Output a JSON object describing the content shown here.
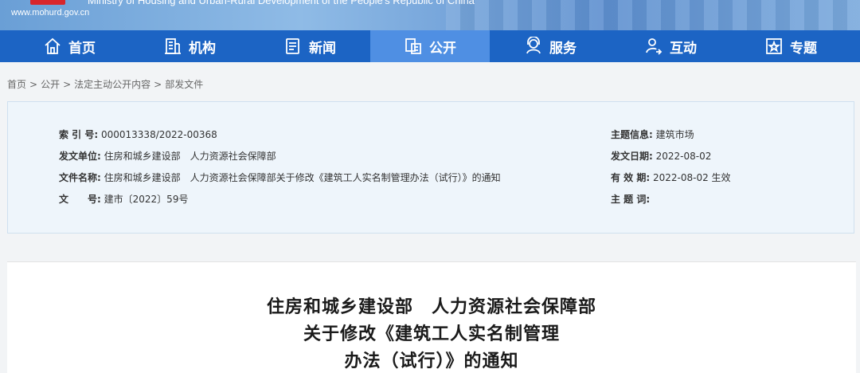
{
  "header": {
    "url": "www.mohurd.gov.cn",
    "english_name": "Ministry of Housing and Urban-Rural Development of the People's Republic of China"
  },
  "nav": [
    {
      "label": "首页",
      "icon": "home-icon"
    },
    {
      "label": "机构",
      "icon": "building-icon"
    },
    {
      "label": "新闻",
      "icon": "news-icon"
    },
    {
      "label": "公开",
      "icon": "open-doc-icon",
      "active": true
    },
    {
      "label": "服务",
      "icon": "service-icon"
    },
    {
      "label": "互动",
      "icon": "interaction-icon"
    },
    {
      "label": "专题",
      "icon": "topic-star-icon"
    }
  ],
  "breadcrumb": [
    "首页",
    "公开",
    "法定主动公开内容",
    "部发文件"
  ],
  "meta": {
    "index_no_key": "索 引 号:",
    "index_no_val": "000013338/2022-00368",
    "issuer_key": "发文单位:",
    "issuer_val": "住房和城乡建设部　人力资源社会保障部",
    "filename_key": "文件名称:",
    "filename_val": "住房和城乡建设部　人力资源社会保障部关于修改《建筑工人实名制管理办法（试行）》的通知",
    "docno_key": "文　　号:",
    "docno_val": "建市〔2022〕59号",
    "topic_key": "主题信息:",
    "topic_val": "建筑市场",
    "date_key": "发文日期:",
    "date_val": "2022-08-02",
    "valid_key": "有 效 期:",
    "valid_val": "2022-08-02 生效",
    "keywords_key": "主 题 词:",
    "keywords_val": ""
  },
  "article": {
    "title_lines": [
      "住房和城乡建设部　人力资源社会保障部",
      "关于修改《建筑工人实名制管理",
      "办法（试行）》的通知"
    ]
  },
  "colors": {
    "nav_bg": "#1c64c4",
    "nav_active": "#4f8fe3",
    "meta_bg": "#eef5fb"
  }
}
